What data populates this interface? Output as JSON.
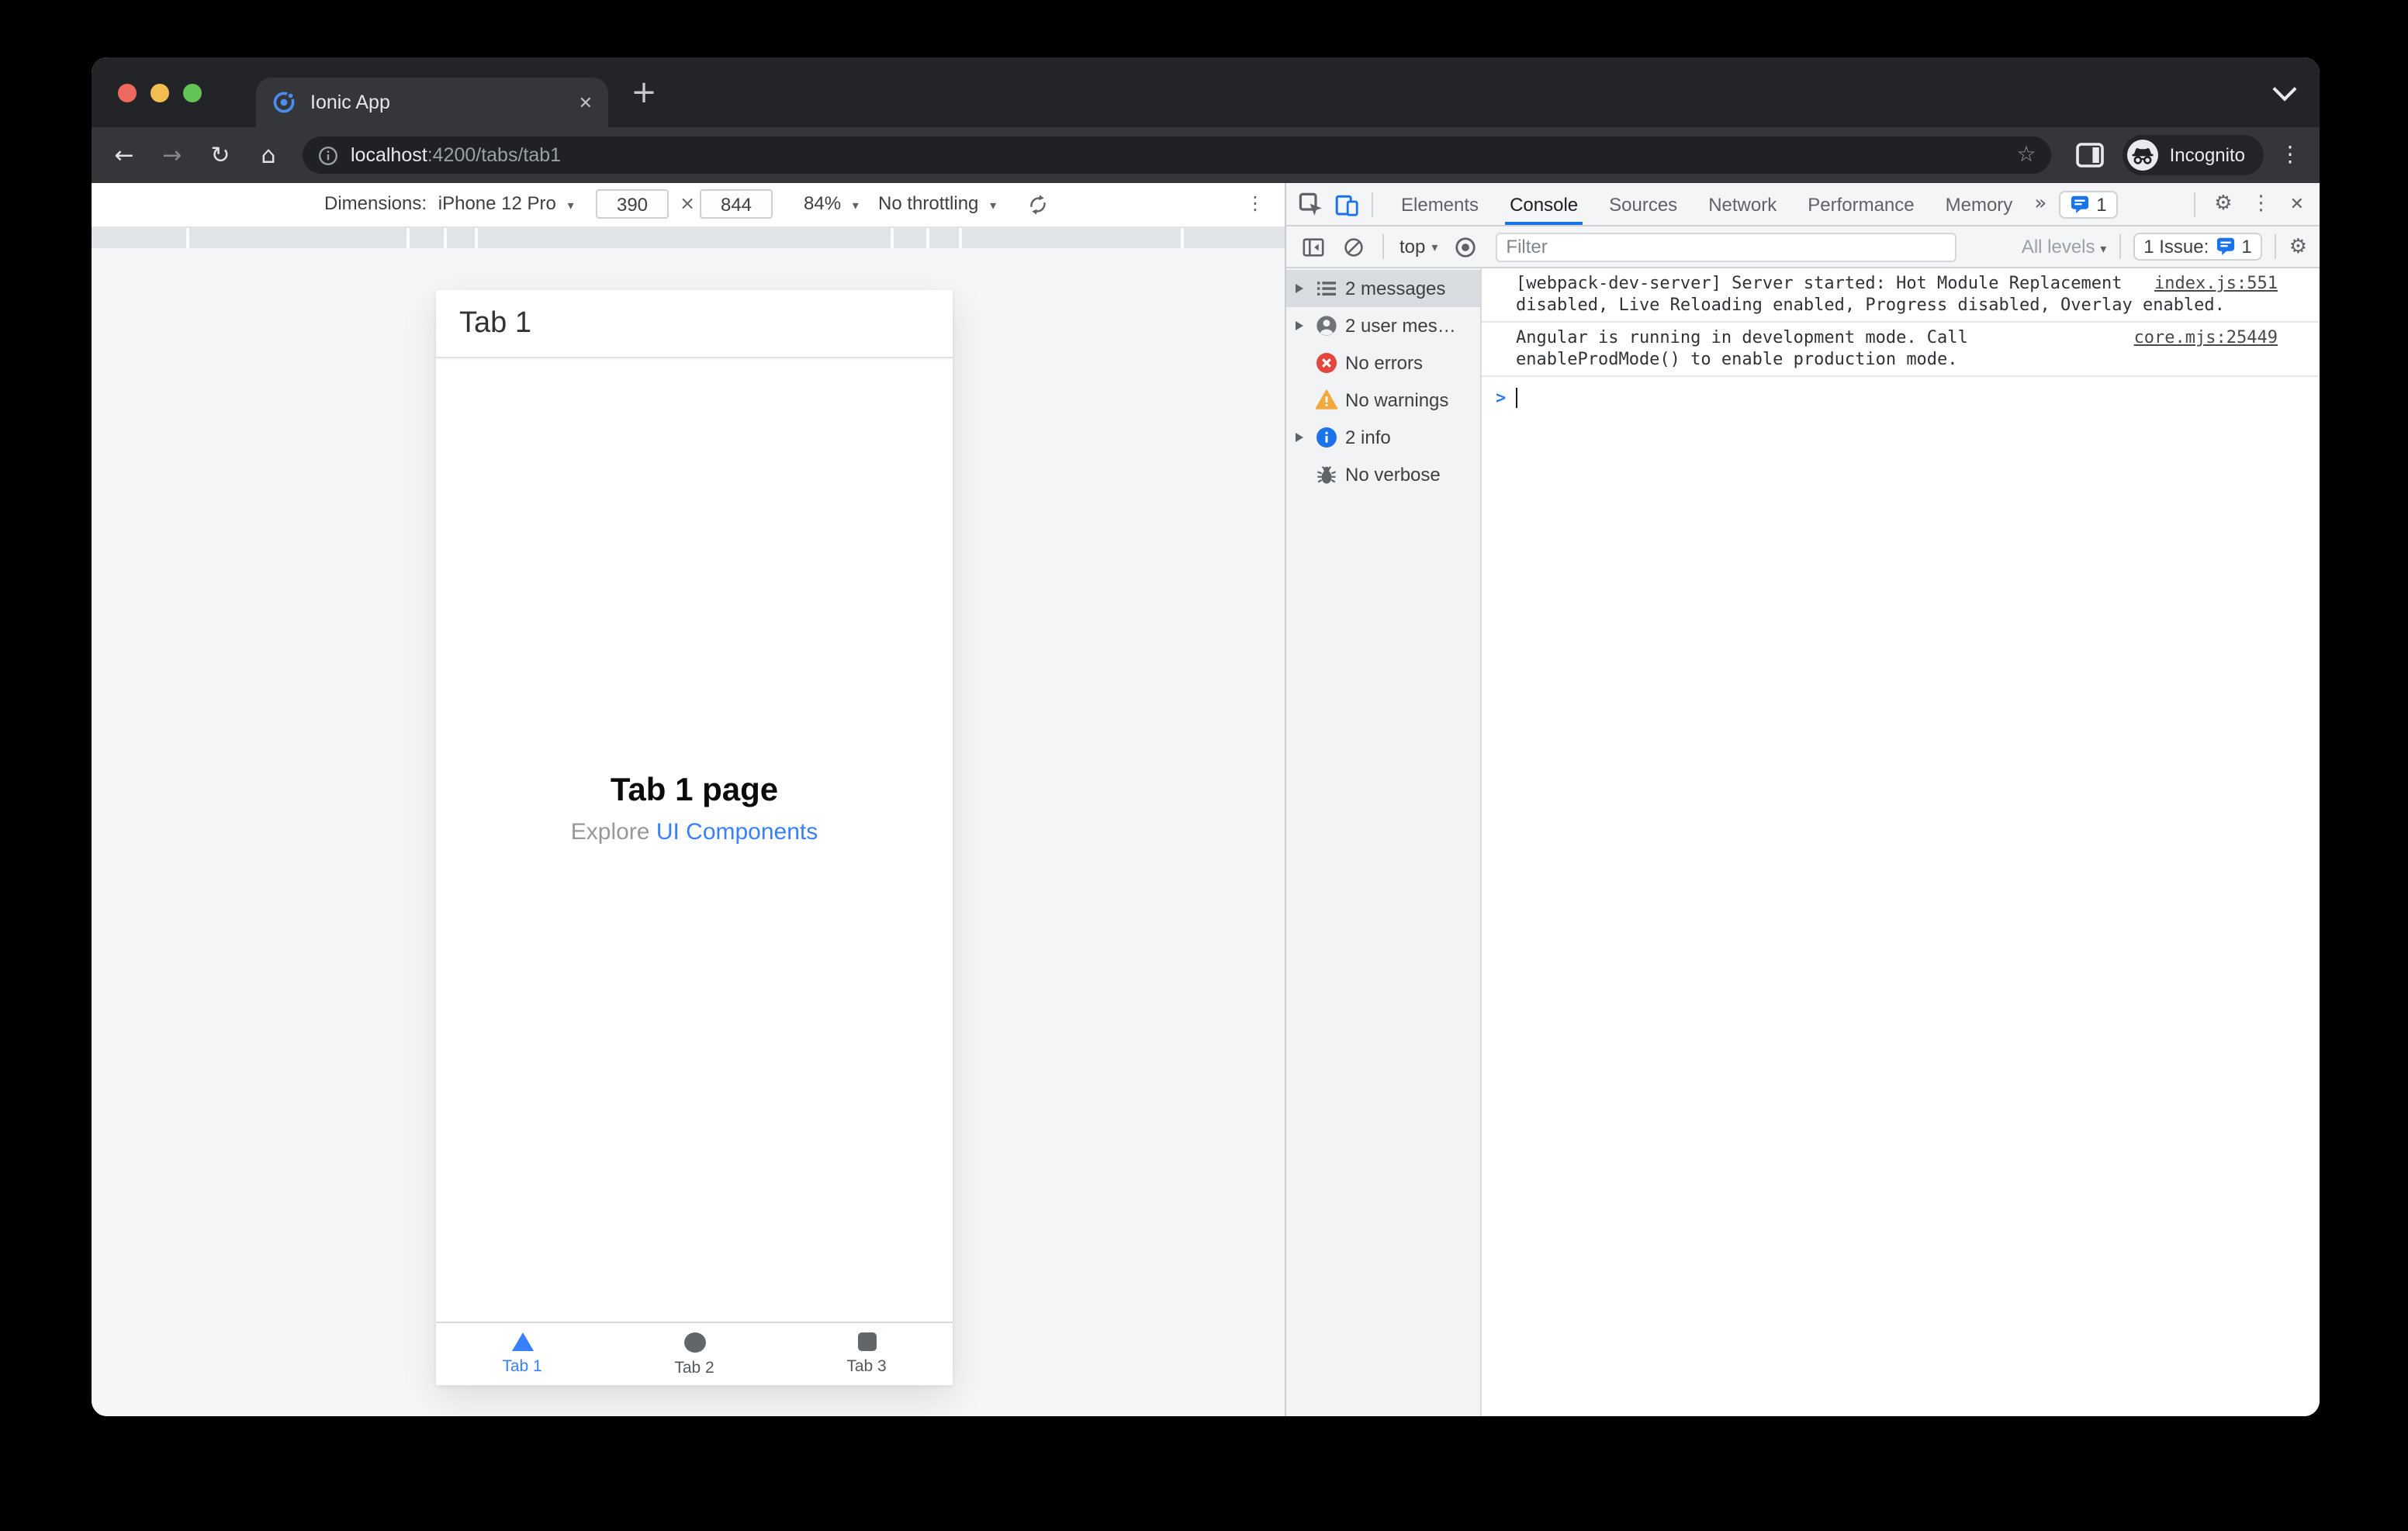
{
  "glyphs": {
    "back": "←",
    "forward": "→",
    "reload": "↻",
    "home": "⌂",
    "star": "☆",
    "menu": "⋮",
    "close": "✕",
    "new_tab": "+",
    "caret_down": "▾",
    "more_tabs": "»",
    "gear": "⚙",
    "times": "×",
    "prompt": ">",
    "ellipsis_tab_close": "✕"
  },
  "window": {
    "tab_title": "Ionic App",
    "incognito_label": "Incognito",
    "url_host": "localhost",
    "url_path": ":4200/tabs/tab1"
  },
  "device_toolbar": {
    "dimensions_label": "Dimensions:",
    "device": "iPhone 12 Pro",
    "width": "390",
    "height": "844",
    "zoom": "84%",
    "throttling": "No throttling"
  },
  "devtools": {
    "tabs": [
      {
        "label": "Elements",
        "active": false
      },
      {
        "label": "Console",
        "active": true
      },
      {
        "label": "Sources",
        "active": false
      },
      {
        "label": "Network",
        "active": false
      },
      {
        "label": "Performance",
        "active": false
      },
      {
        "label": "Memory",
        "active": false
      }
    ],
    "topbar_issues_count": "1",
    "console_toolbar": {
      "context": "top",
      "filter_placeholder": "Filter",
      "levels": "All levels",
      "issues_text": "1 Issue:",
      "issues_count": "1"
    },
    "sidebar": [
      {
        "icon": "list-icon",
        "label": "2 messages",
        "expandable": true,
        "selected": true
      },
      {
        "icon": "user-icon",
        "label": "2 user mes…",
        "expandable": true,
        "selected": false
      },
      {
        "icon": "error-icon",
        "label": "No errors",
        "expandable": false,
        "selected": false
      },
      {
        "icon": "warning-icon",
        "label": "No warnings",
        "expandable": false,
        "selected": false
      },
      {
        "icon": "info-icon",
        "label": "2 info",
        "expandable": true,
        "selected": false
      },
      {
        "icon": "bug-icon",
        "label": "No verbose",
        "expandable": false,
        "selected": false
      }
    ],
    "messages": [
      {
        "lines": [
          "[webpack-dev-server] Server started: Hot Module Replacement",
          "disabled, Live Reloading enabled, Progress disabled, Overlay enabled."
        ],
        "source": "index.js:551"
      },
      {
        "lines": [
          "Angular is running in development mode. Call",
          "enableProdMode() to enable production mode."
        ],
        "source": "core.mjs:25449"
      }
    ]
  },
  "app": {
    "header_title": "Tab 1",
    "page_title": "Tab 1 page",
    "subtitle_text": "Explore",
    "subtitle_link": "UI Components",
    "tabs": [
      {
        "label": "Tab 1",
        "icon": "triangle-icon",
        "active": true
      },
      {
        "label": "Tab 2",
        "icon": "circle-icon",
        "active": false
      },
      {
        "label": "Tab 3",
        "icon": "square-icon",
        "active": false
      }
    ]
  },
  "colors": {
    "devtools_accent": "#1a73e8",
    "ionic_blue": "#3880ff",
    "error_red": "#e5463d",
    "warning_yellow": "#f2a93c",
    "info_blue": "#1a73e8"
  }
}
